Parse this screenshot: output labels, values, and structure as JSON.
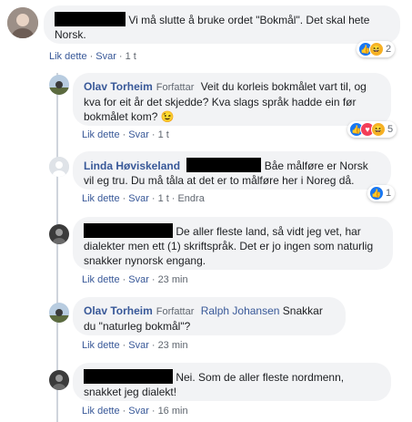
{
  "comments": [
    {
      "text": "Vi må slutte å bruke ordet \"Bokmål\". Det skal hete Norsk.",
      "actions": {
        "like": "Lik dette",
        "reply": "Svar",
        "time": "1 t"
      },
      "reaction_count": "2",
      "reactions": [
        "like-icon",
        "haha-icon"
      ]
    },
    {
      "author": "Olav Torheim",
      "role": "Forfattar",
      "text": "Veit du korleis bokmålet vart til, og kva for eit år det skjedde? Kva slags språk hadde ein før bokmålet kom? 😉",
      "actions": {
        "like": "Lik dette",
        "reply": "Svar",
        "time": "1 t"
      },
      "reaction_count": "5",
      "reactions": [
        "like-icon",
        "love-icon",
        "haha-icon"
      ]
    },
    {
      "author": "Linda Høviskeland",
      "text": "Båe målføre er Norsk vil eg tru. Du må tåla at det er to målføre her i Noreg då.",
      "actions": {
        "like": "Lik dette",
        "reply": "Svar",
        "time": "1 t",
        "edited": "Endra"
      },
      "reaction_count": "1",
      "reactions": [
        "like-icon"
      ]
    },
    {
      "text": "De aller fleste land, så vidt jeg vet, har dialekter men ett (1) skriftspråk. Det er jo ingen som naturlig snakker nynorsk engang.",
      "actions": {
        "like": "Lik dette",
        "reply": "Svar",
        "time": "23 min"
      }
    },
    {
      "author": "Olav Torheim",
      "role": "Forfattar",
      "mention": "Ralph Johansen",
      "text": "Snakkar du \"naturleg bokmål\"?",
      "actions": {
        "like": "Lik dette",
        "reply": "Svar",
        "time": "23 min"
      }
    },
    {
      "text": "Nei. Som de aller fleste nordmenn, snakket jeg dialekt!",
      "actions": {
        "like": "Lik dette",
        "reply": "Svar",
        "time": "16 min"
      }
    }
  ],
  "colors": {
    "link": "#385898",
    "bubble": "#f2f3f5",
    "meta": "#606770",
    "like": "#1877f2"
  }
}
